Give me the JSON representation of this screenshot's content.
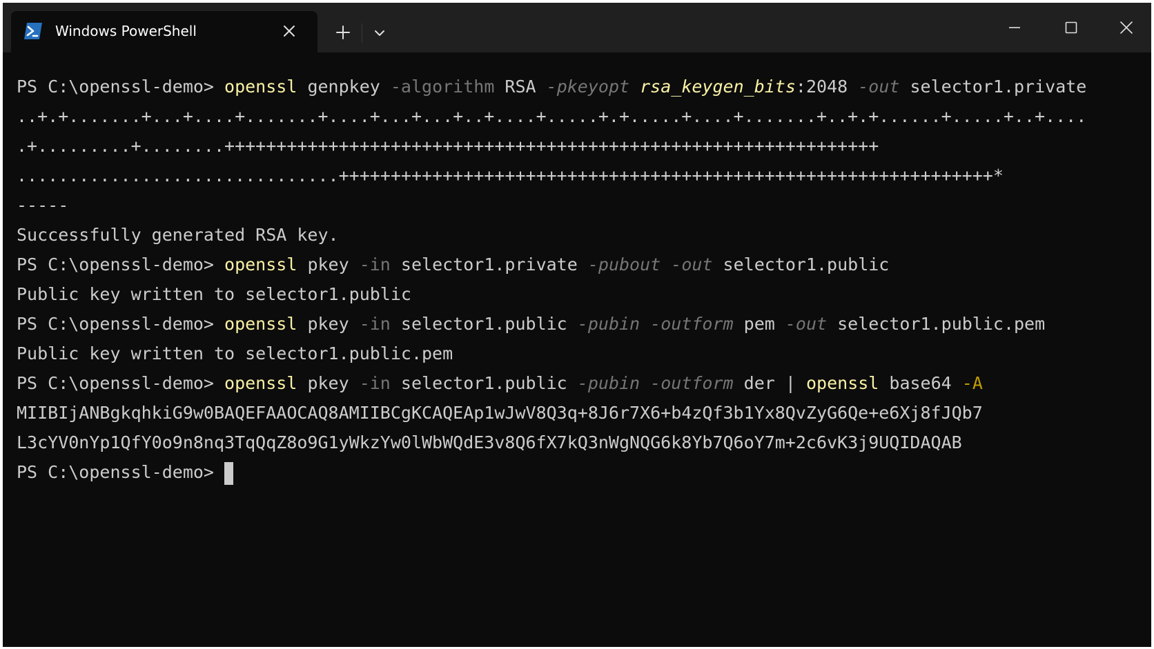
{
  "window": {
    "tab_title": "Windows PowerShell",
    "icons": {
      "tab_icon": "powershell-icon",
      "tab_close": "close-icon",
      "new_tab": "plus-icon",
      "dropdown": "chevron-down-icon",
      "minimize": "minimize-icon",
      "maximize": "maximize-icon",
      "close": "close-icon"
    },
    "colors": {
      "background": "#0c0c0c",
      "titlebar": "#202020",
      "command": "#f9f1a5",
      "parameter": "#767676",
      "text": "#cccccc",
      "accent": "#c19c00",
      "powershell_blue": "#2671be"
    }
  },
  "terminal": {
    "prompt": "PS C:\\openssl-demo> ",
    "cmd1": {
      "c1": "openssl",
      "a1": " genpkey ",
      "p1": "-algorithm",
      "a2": " RSA ",
      "p2": "-pkeyopt",
      "sp": " ",
      "a3": "rsa_keygen_bits",
      "a4": ":2048 ",
      "p3": "-out",
      "a5": " selector1.private"
    },
    "out1": "..+.+.......+...+....+.......+....+...+...+..+....+.....+.+.....+....+.......+..+.+......+.....+..+....",
    "out2": ".+.........+........+++++++++++++++++++++++++++++++++++++++++++++++++++++++++++++++",
    "out3": "...............................+++++++++++++++++++++++++++++++++++++++++++++++++++++++++++++++*",
    "out4": "-----",
    "out5": "Successfully generated RSA key.",
    "cmd2": {
      "c1": "openssl",
      "a1": " pkey ",
      "p1": "-in",
      "a2": " selector1.private ",
      "p2": "-pubout",
      "sp": " ",
      "p3": "-out",
      "a3": " selector1.public"
    },
    "out6": "Public key written to selector1.public",
    "cmd3": {
      "c1": "openssl",
      "a1": " pkey ",
      "p1": "-in",
      "a2": " selector1.public ",
      "p2": "-pubin",
      "sp": " ",
      "p3": "-outform",
      "a3": " pem ",
      "p4": "-out",
      "a4": " selector1.public.pem"
    },
    "out7": "Public key written to selector1.public.pem",
    "cmd4": {
      "c1": "openssl",
      "a1": " pkey ",
      "p1": "-in",
      "a2": " selector1.public ",
      "p2": "-pubin",
      "sp": " ",
      "p3": "-outform",
      "a3": " der ",
      "pipe": "|",
      "sp2": " ",
      "c2": "openssl",
      "a4": " base64 ",
      "f1": "-A"
    },
    "out8": "MIIBIjANBgkqhkiG9w0BAQEFAAOCAQ8AMIIBCgKCAQEAp1wJwV8Q3q+8J6r7X6+b4zQf3b1Yx8QvZyG6Qe+e6Xj8fJQb7",
    "out9": "L3cYV0nYp1QfY0o9n8nq3TqQqZ8o9G1yWkzYw0lWbWQdE3v8Q6fX7kQ3nWgNQG6k8Yb7Q6oY7m+2c6vK3j9UQIDAQAB"
  }
}
